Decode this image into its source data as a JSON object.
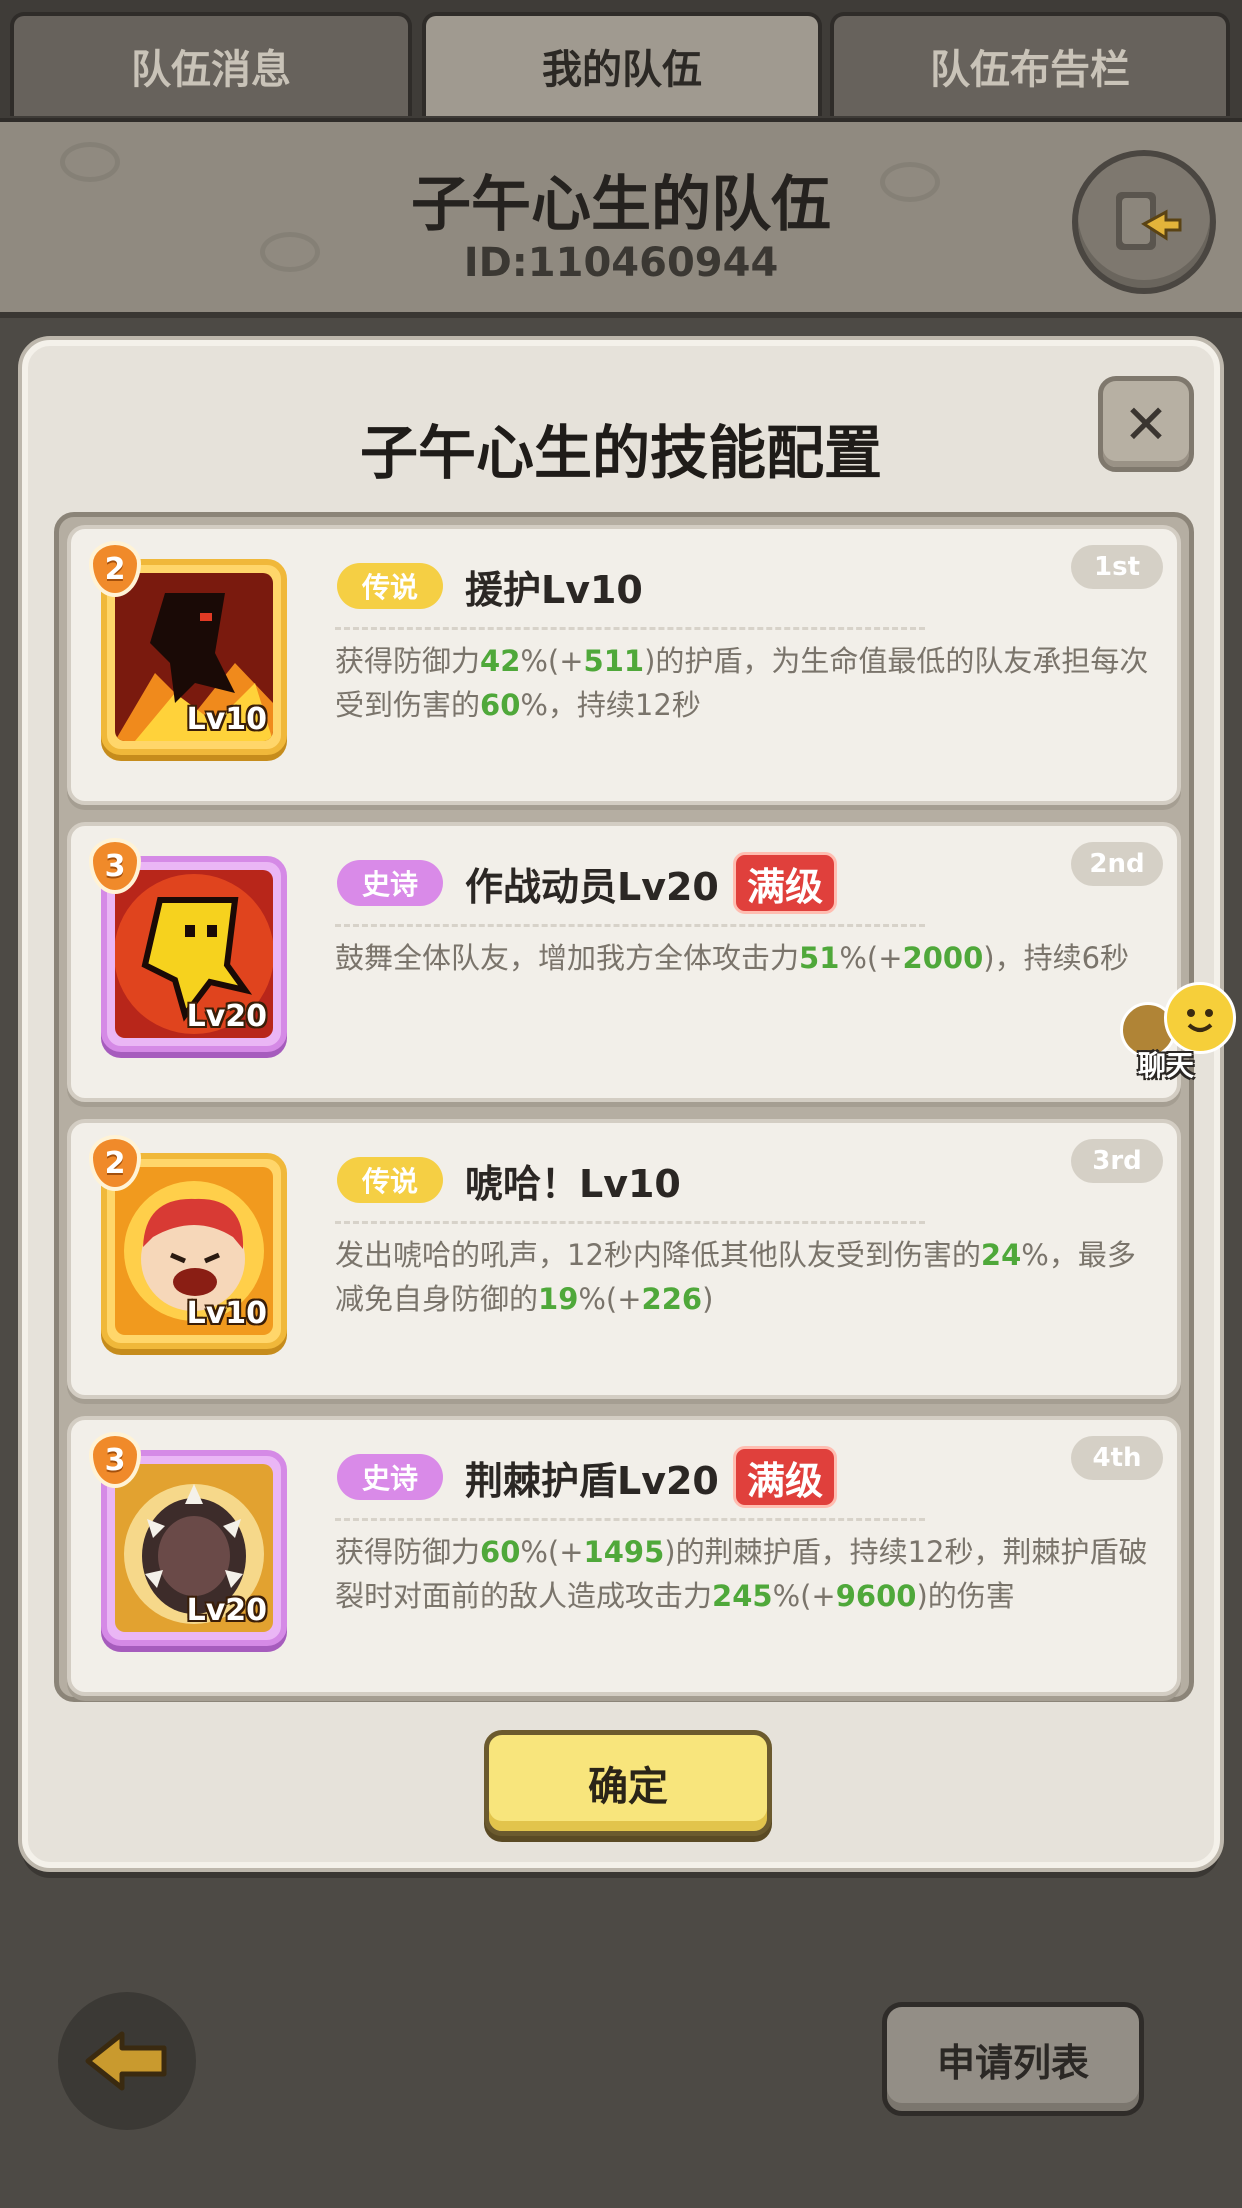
{
  "tabs": [
    "队伍消息",
    "我的队伍",
    "队伍布告栏"
  ],
  "active_tab": 1,
  "team": {
    "title": "子午心生的队伍",
    "id_text": "ID:110460944"
  },
  "dialog": {
    "title": "子午心生的技能配置",
    "close_label": "✕",
    "confirm_label": "确定"
  },
  "skills": [
    {
      "rank": "1st",
      "cost": "2",
      "rarity": "传说",
      "rarity_type": "legend",
      "name": "援护Lv10",
      "icon_level": "Lv10",
      "maxed": "",
      "icon": "shield-guard-icon",
      "desc": [
        {
          "t": "获得防御力",
          "g": false
        },
        {
          "t": "42",
          "g": true
        },
        {
          "t": "%(+",
          "g": false
        },
        {
          "t": "511",
          "g": true
        },
        {
          "t": ")的护盾，为生命值最低的队友承担每次受到伤害的",
          "g": false
        },
        {
          "t": "60",
          "g": true
        },
        {
          "t": "%，持续12秒",
          "g": false
        }
      ]
    },
    {
      "rank": "2nd",
      "cost": "3",
      "rarity": "史诗",
      "rarity_type": "epic",
      "name": "作战动员Lv20",
      "icon_level": "Lv20",
      "maxed": "满级",
      "icon": "rally-shout-icon",
      "desc": [
        {
          "t": "鼓舞全体队友，增加我方全体攻击力",
          "g": false
        },
        {
          "t": "51",
          "g": true
        },
        {
          "t": "%(+",
          "g": false
        },
        {
          "t": "2000",
          "g": true
        },
        {
          "t": ")，持续6秒",
          "g": false
        }
      ]
    },
    {
      "rank": "3rd",
      "cost": "2",
      "rarity": "传说",
      "rarity_type": "legend",
      "name": "唬哈！Lv10",
      "icon_level": "Lv10",
      "maxed": "",
      "icon": "roar-face-icon",
      "desc": [
        {
          "t": "发出唬哈的吼声，12秒内降低其他队友受到伤害的",
          "g": false
        },
        {
          "t": "24",
          "g": true
        },
        {
          "t": "%，最多减免自身防御的",
          "g": false
        },
        {
          "t": "19",
          "g": true
        },
        {
          "t": "%(+",
          "g": false
        },
        {
          "t": "226",
          "g": true
        },
        {
          "t": ")",
          "g": false
        }
      ]
    },
    {
      "rank": "4th",
      "cost": "3",
      "rarity": "史诗",
      "rarity_type": "epic",
      "name": "荆棘护盾Lv20",
      "icon_level": "Lv20",
      "maxed": "满级",
      "icon": "thorn-shield-icon",
      "desc": [
        {
          "t": "获得防御力",
          "g": false
        },
        {
          "t": "60",
          "g": true
        },
        {
          "t": "%(+",
          "g": false
        },
        {
          "t": "1495",
          "g": true
        },
        {
          "t": ")的荆棘护盾，持续12秒，荆棘护盾破裂时对面前的敌人造成攻击力",
          "g": false
        },
        {
          "t": "245",
          "g": true
        },
        {
          "t": "%(+",
          "g": false
        },
        {
          "t": "9600",
          "g": true
        },
        {
          "t": ")的伤害",
          "g": false
        }
      ]
    }
  ],
  "chat_label": "聊天",
  "bottom": {
    "apply_list_label": "申请列表"
  },
  "colors": {
    "legend": "#f5cf44",
    "epic": "#d98ae8",
    "highlight_green": "#4fa83a",
    "maxed_red": "#e0403c"
  }
}
